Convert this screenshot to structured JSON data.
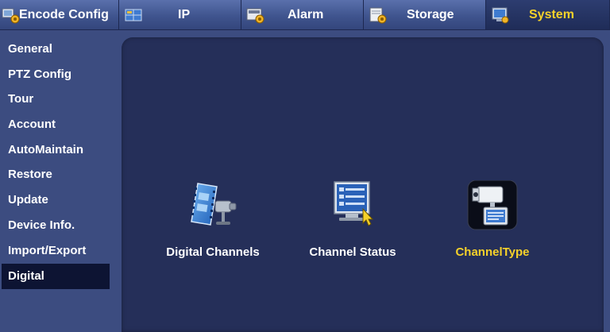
{
  "tabs": [
    {
      "label": "Encode Config",
      "icon": "encode-config-icon",
      "active": false
    },
    {
      "label": "IP",
      "icon": "ip-network-icon",
      "active": false
    },
    {
      "label": "Alarm",
      "icon": "alarm-icon",
      "active": false
    },
    {
      "label": "Storage",
      "icon": "storage-icon",
      "active": false
    },
    {
      "label": "System",
      "icon": "system-icon",
      "active": true
    }
  ],
  "sidebar": {
    "items": [
      {
        "label": "General"
      },
      {
        "label": "PTZ Config"
      },
      {
        "label": "Tour"
      },
      {
        "label": "Account"
      },
      {
        "label": "AutoMaintain"
      },
      {
        "label": "Restore"
      },
      {
        "label": "Update"
      },
      {
        "label": "Device Info."
      },
      {
        "label": "Import/Export"
      },
      {
        "label": "Digital",
        "active": true
      }
    ]
  },
  "main": {
    "tiles": [
      {
        "label": "Digital Channels",
        "icon": "digital-channels-icon"
      },
      {
        "label": "Channel Status",
        "icon": "channel-status-icon"
      },
      {
        "label": "ChannelType",
        "icon": "channel-type-icon",
        "selected": true
      }
    ]
  },
  "colors": {
    "accent": "#f5d12a",
    "background": "#3c4c80",
    "panel": "#252f59",
    "sidebar_selected": "#0d1433"
  }
}
